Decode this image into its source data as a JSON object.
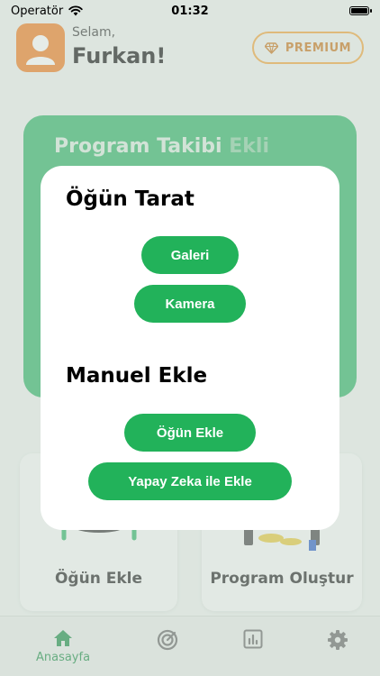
{
  "status": {
    "carrier": "Operatör",
    "time": "01:32"
  },
  "header": {
    "greeting": "Selam,",
    "name": "Furkan!",
    "premium_label": "PREMIUM"
  },
  "program_card": {
    "title": "Program Takibi",
    "ghost": "Ekli"
  },
  "features": {
    "meal_add_label": "Öğün Ekle",
    "program_create_label": "Program Oluştur"
  },
  "tabs": {
    "home_label": "Anasayfa"
  },
  "modal": {
    "scan_heading": "Öğün Tarat",
    "gallery_label": "Galeri",
    "camera_label": "Kamera",
    "manual_heading": "Manuel Ekle",
    "add_meal_label": "Öğün Ekle",
    "ai_add_label": "Yapay Zeka ile Ekle"
  },
  "colors": {
    "primary": "#22b25a",
    "premium": "#f2a53a",
    "avatar": "#f07c1e"
  },
  "icons": [
    "wifi-icon",
    "battery-icon",
    "user-avatar-icon",
    "gem-icon",
    "home-icon",
    "target-icon",
    "chart-icon",
    "gear-icon"
  ]
}
